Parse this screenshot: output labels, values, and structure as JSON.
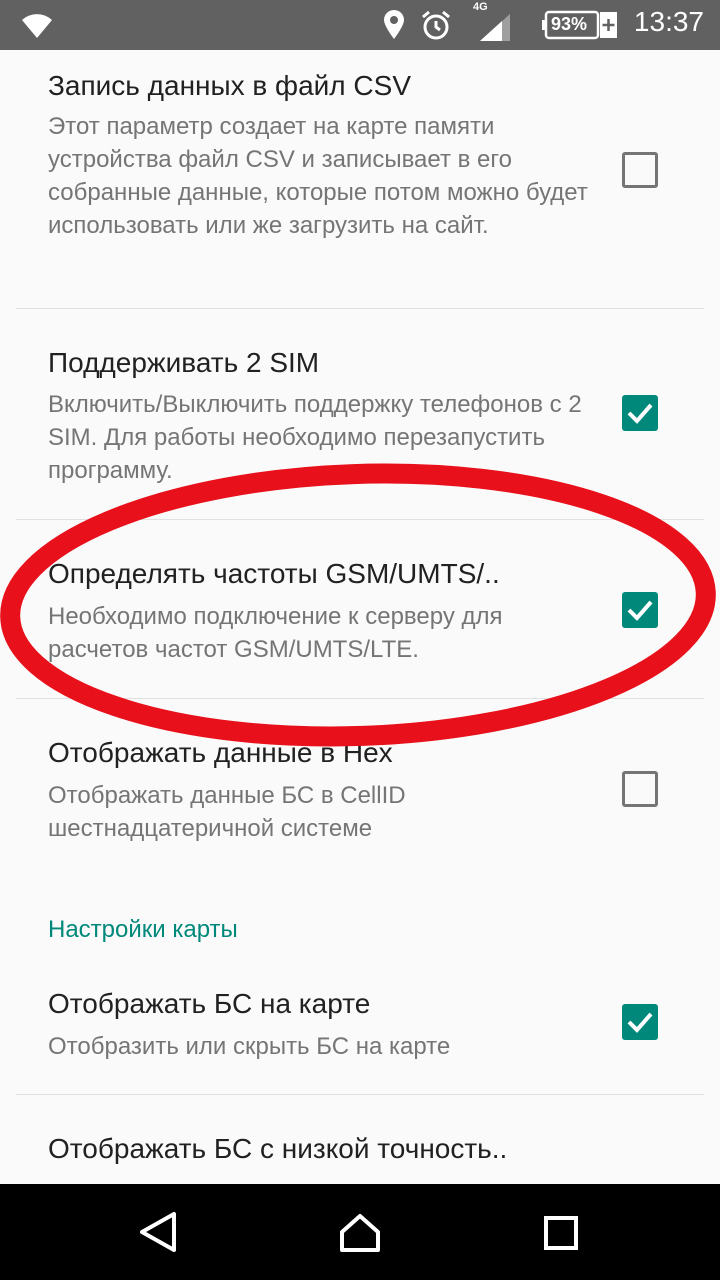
{
  "status_bar": {
    "network_type": "4G",
    "battery_percent": "93%",
    "time": "13:37",
    "icons": [
      "wifi-icon",
      "location-icon",
      "alarm-icon",
      "signal-icon",
      "battery-icon"
    ]
  },
  "preferences": [
    {
      "title": "Запись данных в файл CSV",
      "summary": "Этот параметр создает на карте памяти устройства файл CSV и записывает в его собранные данные, которые потом можно будет использовать или же загрузить на сайт.",
      "checked": false
    },
    {
      "title": "Поддерживать 2 SIM",
      "summary": "Включить/Выключить поддержку телефонов с 2 SIM. Для работы необходимо перезапустить программу.",
      "checked": true
    },
    {
      "title": "Определять частоты GSM/UMTS/..",
      "summary": "Необходимо подключение к серверу для расчетов частот GSM/UMTS/LTE.",
      "checked": true
    },
    {
      "title": "Отображать данные в Hex",
      "summary": "Отображать данные БС в CellID шестнадцатеричной системе",
      "checked": false
    }
  ],
  "map_category": {
    "title": "Настройки карты"
  },
  "map_preferences": [
    {
      "title": "Отображать БС на карте",
      "summary": "Отобразить или скрыть БС на карте",
      "checked": true
    },
    {
      "title": "Отображать БС с низкой точность..",
      "summary": "",
      "checked": false
    }
  ],
  "colors": {
    "accent": "#00897b",
    "status_bar": "#616161",
    "annotation_red": "#e8101a"
  },
  "nav_bar": {
    "icons": [
      "back-icon",
      "home-icon",
      "recents-icon"
    ]
  }
}
